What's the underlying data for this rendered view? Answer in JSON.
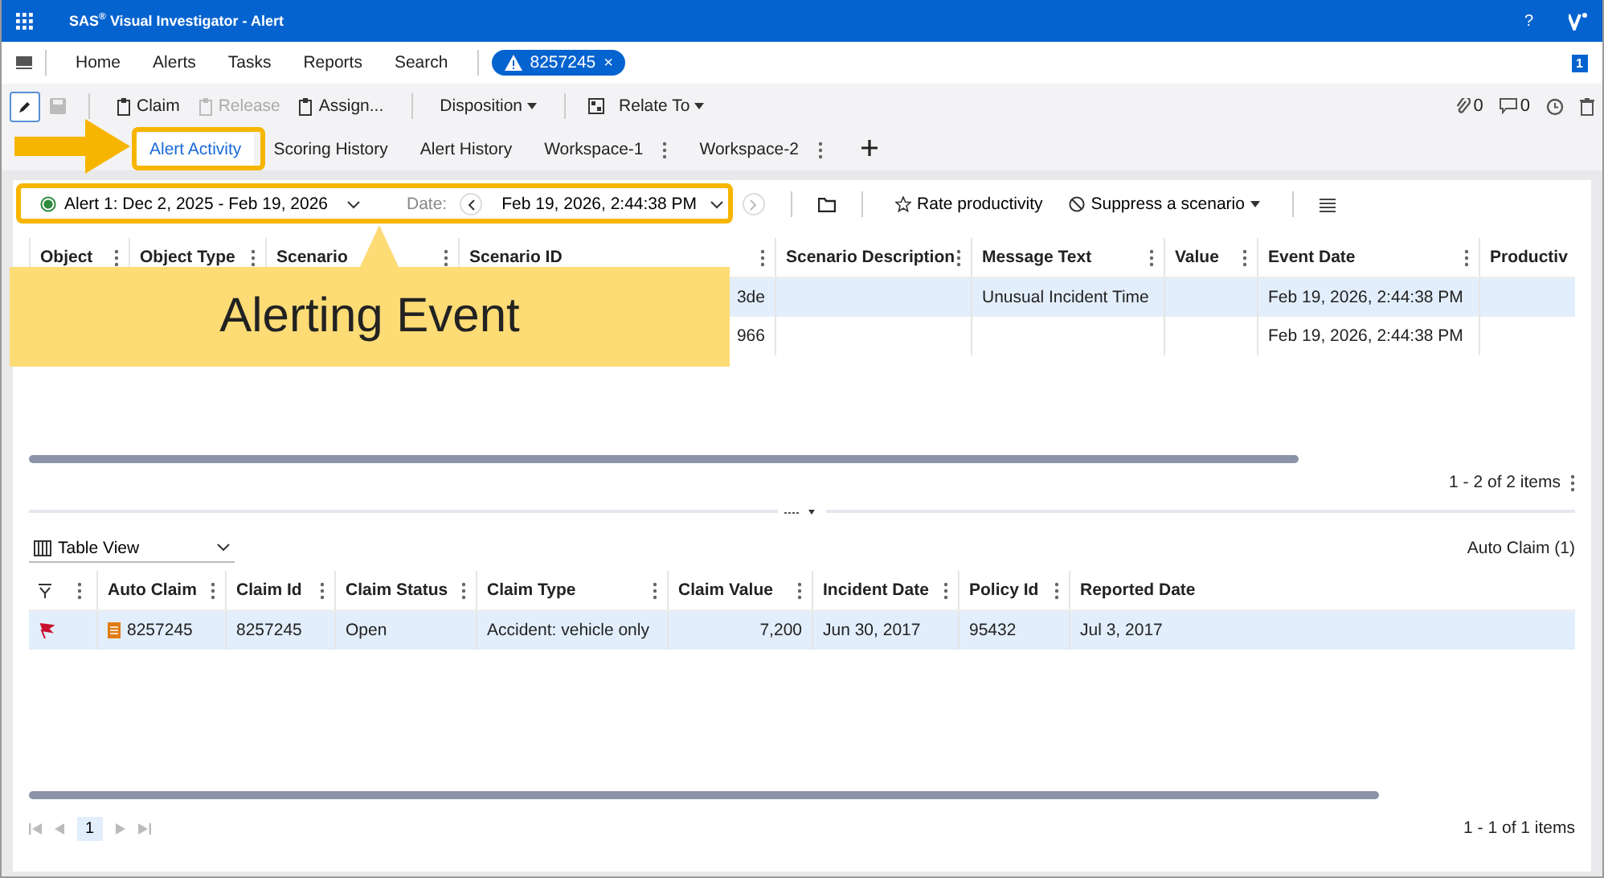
{
  "title_bar": {
    "title": "SAS$^{®}$ Visual Investigator - Alert",
    "help": "?"
  },
  "nav": {
    "items": [
      "Home",
      "Alerts",
      "Tasks",
      "Reports",
      "Search"
    ],
    "open_alert": {
      "label": "8257245",
      "close": "×"
    },
    "badge": "1"
  },
  "toolbar": {
    "buttons": [
      {
        "label": "Claim",
        "disabled": false
      },
      {
        "label": "Release",
        "disabled": true
      },
      {
        "label": "Assign...",
        "disabled": false
      }
    ],
    "disposition": "Disposition",
    "relate_to": "Relate To",
    "attachments": "0",
    "comments": "0"
  },
  "tabs": [
    {
      "label": "Alert Activity",
      "selected": true,
      "menu": false
    },
    {
      "label": "Scoring History",
      "selected": false,
      "menu": false
    },
    {
      "label": "Alert History",
      "selected": false,
      "menu": false
    },
    {
      "label": "Workspace-1",
      "selected": false,
      "menu": true
    },
    {
      "label": "Workspace-2",
      "selected": false,
      "menu": true
    }
  ],
  "callout": {
    "text": "Alerting Event"
  },
  "filter_bar": {
    "alert": "Alert 1: Dec 2, 2025 - Feb 19, 2026",
    "date_label": "Date:",
    "date": "Feb 19, 2026, 2:44:38 PM",
    "rate": "Rate productivity",
    "suppress": "Suppress a scenario"
  },
  "events_table": {
    "columns": [
      "Object",
      "Object Type",
      "Scenario",
      "Scenario ID",
      "Scenario Description",
      "Message Text",
      "Value",
      "Event Date",
      "Productiv"
    ],
    "rows": [
      {
        "selected": true,
        "scenario_id": "3de",
        "message_text": "Unusual Incident Time",
        "event_date": "Feb 19, 2026, 2:44:38 PM"
      },
      {
        "selected": false,
        "scenario_id": "966",
        "event_date": "Feb 19, 2026, 2:44:38 PM"
      }
    ],
    "footer": "1 - 2 of 2 items"
  },
  "claims": {
    "view": "Table View",
    "title": "Auto Claim (1)",
    "columns": [
      "Auto Claim",
      "Claim Id",
      "Claim Status",
      "Claim Type",
      "Claim Value",
      "Incident Date",
      "Policy Id",
      "Reported Date"
    ],
    "rows": [
      {
        "selected": true,
        "flagged": true,
        "cells": [
          "8257245",
          "8257245",
          "Open",
          "Accident: vehicle only",
          "7,200",
          "Jun 30, 2017",
          "95432",
          "Jul 3, 2017"
        ]
      }
    ],
    "page": "1",
    "footer": "1 - 1 of 1 items"
  }
}
